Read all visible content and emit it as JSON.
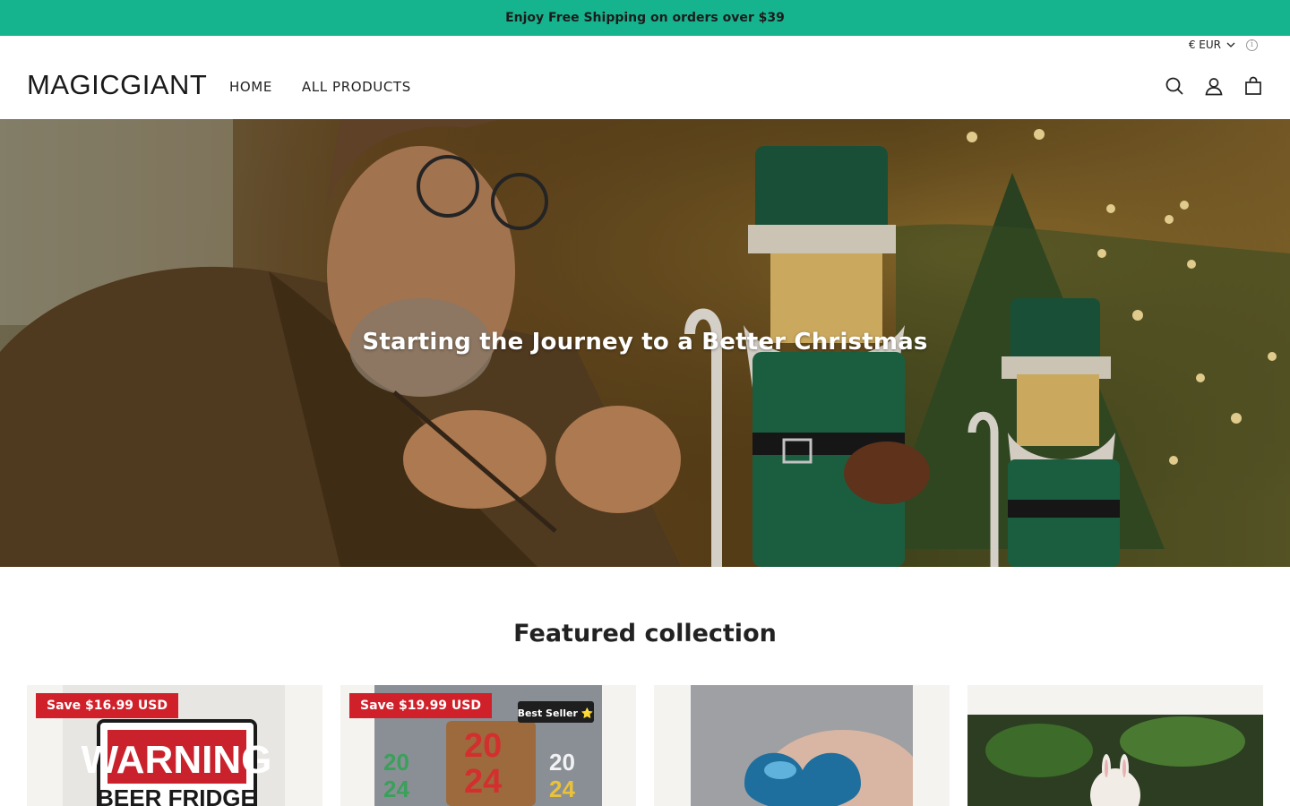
{
  "announcement": {
    "text": "Enjoy Free Shipping on orders over $39"
  },
  "header": {
    "currency": "€ EUR",
    "logo": "MAGICGIANT",
    "nav": [
      "HOME",
      "ALL PRODUCTS"
    ],
    "icons": [
      "search-icon",
      "account-icon",
      "cart-icon"
    ]
  },
  "hero": {
    "title": "Starting the Journey to a Better Christmas"
  },
  "featured": {
    "title": "Featured collection",
    "products": [
      {
        "badge": "Save $16.99 USD",
        "image_text": [
          "WARNING",
          "BEER FRIDGE"
        ]
      },
      {
        "badge": "Save $19.99 USD",
        "tag": "Best Seller ⭐",
        "image_text": [
          "20",
          "24"
        ]
      },
      {
        "badge": ""
      },
      {
        "badge": ""
      }
    ]
  },
  "colors": {
    "accent": "#16b48e",
    "sale": "#d0202a"
  }
}
